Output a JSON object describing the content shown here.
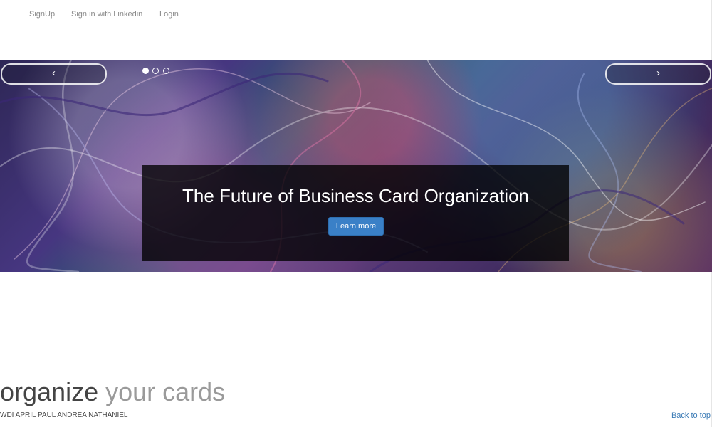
{
  "nav": {
    "items": [
      "SignUp",
      "Sign in with Linkedin",
      "Login"
    ]
  },
  "carousel": {
    "prev_label": "‹",
    "next_label": "›",
    "indicators": 3,
    "active_indicator": 0,
    "caption": {
      "heading": "The Future of Business Card Organization",
      "button_label": "Learn more"
    }
  },
  "featurette": {
    "heading_main": "organize",
    "heading_muted": "your cards"
  },
  "footer": {
    "credits": "WDI APRIL PAUL ANDREA NATHANIEL",
    "back_to_top": "Back to top"
  },
  "colors": {
    "primary_button": "#3a80c7",
    "link": "#3a7ab5",
    "muted_text": "#9a9a9a"
  }
}
